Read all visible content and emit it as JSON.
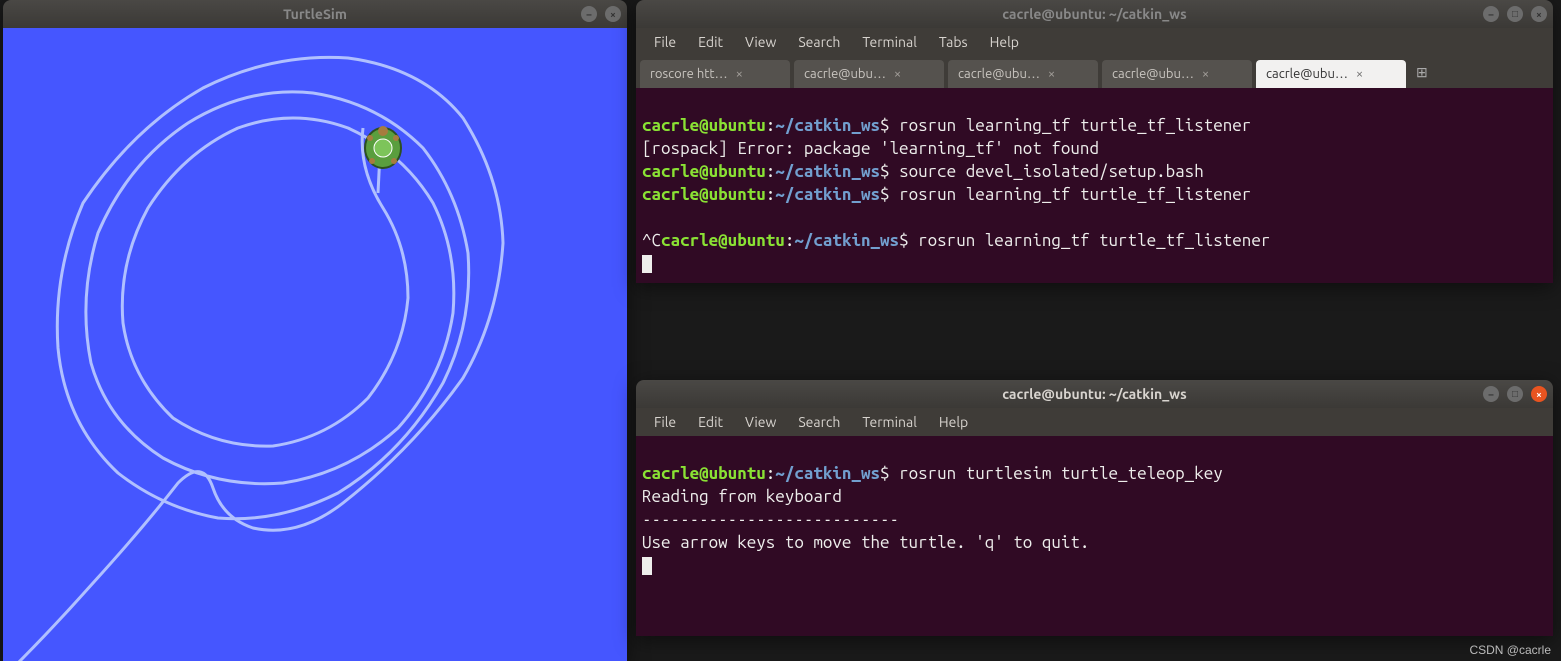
{
  "turtlesim": {
    "title": "TurtleSim"
  },
  "terminal1": {
    "title": "cacrle@ubuntu: ~/catkin_ws",
    "menu": [
      "File",
      "Edit",
      "View",
      "Search",
      "Terminal",
      "Tabs",
      "Help"
    ],
    "tabs": [
      {
        "label": "roscore htt…",
        "active": false
      },
      {
        "label": "cacrle@ubu…",
        "active": false
      },
      {
        "label": "cacrle@ubu…",
        "active": false
      },
      {
        "label": "cacrle@ubu…",
        "active": false
      },
      {
        "label": "cacrle@ubu…",
        "active": true
      }
    ],
    "lines": {
      "l1_user": "cacrle@ubuntu",
      "l1_colon": ":",
      "l1_path": "~/catkin_ws",
      "l1_cmd": "$ rosrun learning_tf turtle_tf_listener",
      "l2": "[rospack] Error: package 'learning_tf' not found",
      "l3_user": "cacrle@ubuntu",
      "l3_colon": ":",
      "l3_path": "~/catkin_ws",
      "l3_cmd": "$ source devel_isolated/setup.bash",
      "l4_user": "cacrle@ubuntu",
      "l4_colon": ":",
      "l4_path": "~/catkin_ws",
      "l4_cmd": "$ rosrun learning_tf turtle_tf_listener",
      "l5": "",
      "l6_pre": "^C",
      "l6_user": "cacrle@ubuntu",
      "l6_colon": ":",
      "l6_path": "~/catkin_ws",
      "l6_cmd": "$ rosrun learning_tf turtle_tf_listener"
    }
  },
  "terminal2": {
    "title": "cacrle@ubuntu: ~/catkin_ws",
    "menu": [
      "File",
      "Edit",
      "View",
      "Search",
      "Terminal",
      "Help"
    ],
    "lines": {
      "l1_user": "cacrle@ubuntu",
      "l1_colon": ":",
      "l1_path": "~/catkin_ws",
      "l1_cmd": "$ rosrun turtlesim turtle_teleop_key",
      "l2": "Reading from keyboard",
      "l3": "---------------------------",
      "l4": "Use arrow keys to move the turtle. 'q' to quit."
    }
  },
  "watermark": "CSDN @cacrle"
}
